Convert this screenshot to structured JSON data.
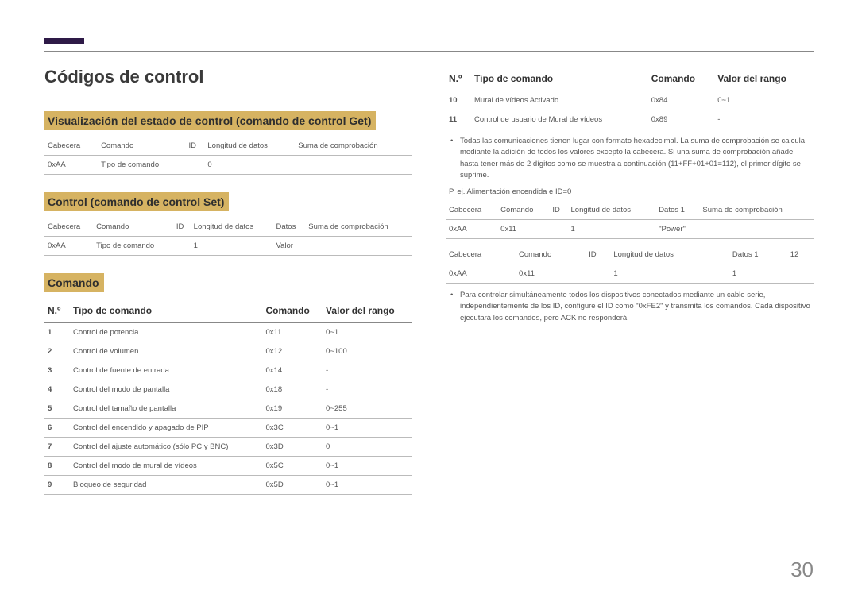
{
  "page_number": "30",
  "title": "Códigos de control",
  "sections": {
    "get": {
      "heading": "Visualización del estado de control (comando de control Get)",
      "headers": [
        "Cabecera",
        "Comando",
        "ID",
        "Longitud de datos",
        "Suma de comprobación"
      ],
      "row": [
        "0xAA",
        "Tipo de comando",
        "",
        "0",
        ""
      ]
    },
    "set": {
      "heading": "Control (comando de control Set)",
      "headers": [
        "Cabecera",
        "Comando",
        "ID",
        "Longitud de datos",
        "Datos",
        "Suma de comprobación"
      ],
      "row": [
        "0xAA",
        "Tipo de comando",
        "",
        "1",
        "Valor",
        ""
      ]
    },
    "cmd": {
      "heading": "Comando",
      "headers": [
        "N.º",
        "Tipo de comando",
        "Comando",
        "Valor del rango"
      ],
      "rows_left": [
        [
          "1",
          "Control de potencia",
          "0x11",
          "0~1"
        ],
        [
          "2",
          "Control de volumen",
          "0x12",
          "0~100"
        ],
        [
          "3",
          "Control de fuente de entrada",
          "0x14",
          "-"
        ],
        [
          "4",
          "Control del modo de pantalla",
          "0x18",
          "-"
        ],
        [
          "5",
          "Control del tamaño de pantalla",
          "0x19",
          "0~255"
        ],
        [
          "6",
          "Control del encendido y apagado de PIP",
          "0x3C",
          "0~1"
        ],
        [
          "7",
          "Control del ajuste automático (sólo PC y BNC)",
          "0x3D",
          "0"
        ],
        [
          "8",
          "Control del modo de mural de vídeos",
          "0x5C",
          "0~1"
        ],
        [
          "9",
          "Bloqueo de seguridad",
          "0x5D",
          "0~1"
        ]
      ],
      "rows_right": [
        [
          "10",
          "Mural de vídeos Activado",
          "0x84",
          "0~1"
        ],
        [
          "11",
          "Control de usuario de Mural de vídeos",
          "0x89",
          "-"
        ]
      ]
    }
  },
  "notes": {
    "checksum": "Todas las comunicaciones tienen lugar con formato hexadecimal. La suma de comprobación se calcula mediante la adición de todos los valores excepto la cabecera. Si una suma de comprobación añade hasta tener más de 2 dígitos como se muestra a continuación (11+FF+01+01=112), el primer dígito se suprime.",
    "example_label": "P. ej. Alimentación encendida e ID=0",
    "simultaneous": "Para controlar simultáneamente todos los dispositivos conectados mediante un cable serie, independientemente de los ID, configure el ID como \"0xFE2\" y transmita los comandos. Cada dispositivo ejecutará los comandos, pero ACK no responderá."
  },
  "example_tables": {
    "t1": {
      "headers": [
        "Cabecera",
        "Comando",
        "ID",
        "Longitud de datos",
        "Datos 1",
        "Suma de comprobación"
      ],
      "row": [
        "0xAA",
        "0x11",
        "",
        "1",
        "\"Power\"",
        ""
      ]
    },
    "t2": {
      "headers": [
        "Cabecera",
        "Comando",
        "ID",
        "Longitud de datos",
        "Datos 1",
        "12"
      ],
      "row": [
        "0xAA",
        "0x11",
        "",
        "1",
        "1",
        ""
      ]
    }
  }
}
